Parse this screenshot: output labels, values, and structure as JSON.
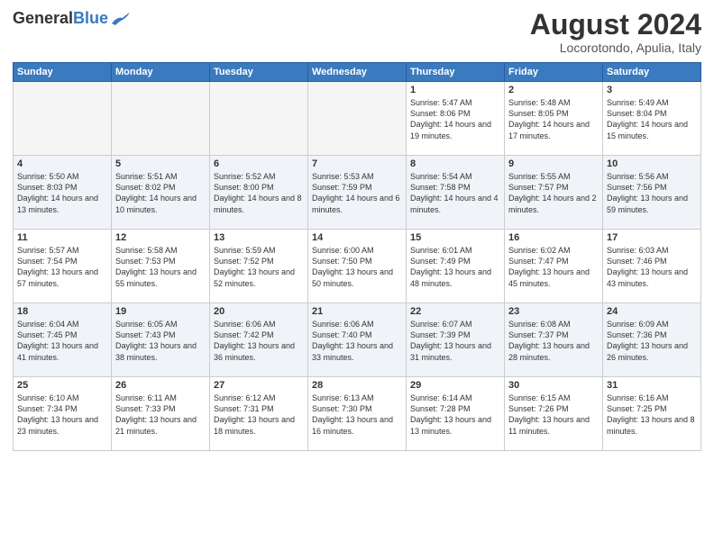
{
  "header": {
    "logo_general": "General",
    "logo_blue": "Blue",
    "title": "August 2024",
    "location": "Locorotondo, Apulia, Italy"
  },
  "days_of_week": [
    "Sunday",
    "Monday",
    "Tuesday",
    "Wednesday",
    "Thursday",
    "Friday",
    "Saturday"
  ],
  "weeks": [
    [
      {
        "day": "",
        "empty": true
      },
      {
        "day": "",
        "empty": true
      },
      {
        "day": "",
        "empty": true
      },
      {
        "day": "",
        "empty": true
      },
      {
        "day": "1",
        "sunrise": "Sunrise: 5:47 AM",
        "sunset": "Sunset: 8:06 PM",
        "daylight": "Daylight: 14 hours and 19 minutes."
      },
      {
        "day": "2",
        "sunrise": "Sunrise: 5:48 AM",
        "sunset": "Sunset: 8:05 PM",
        "daylight": "Daylight: 14 hours and 17 minutes."
      },
      {
        "day": "3",
        "sunrise": "Sunrise: 5:49 AM",
        "sunset": "Sunset: 8:04 PM",
        "daylight": "Daylight: 14 hours and 15 minutes."
      }
    ],
    [
      {
        "day": "4",
        "sunrise": "Sunrise: 5:50 AM",
        "sunset": "Sunset: 8:03 PM",
        "daylight": "Daylight: 14 hours and 13 minutes."
      },
      {
        "day": "5",
        "sunrise": "Sunrise: 5:51 AM",
        "sunset": "Sunset: 8:02 PM",
        "daylight": "Daylight: 14 hours and 10 minutes."
      },
      {
        "day": "6",
        "sunrise": "Sunrise: 5:52 AM",
        "sunset": "Sunset: 8:00 PM",
        "daylight": "Daylight: 14 hours and 8 minutes."
      },
      {
        "day": "7",
        "sunrise": "Sunrise: 5:53 AM",
        "sunset": "Sunset: 7:59 PM",
        "daylight": "Daylight: 14 hours and 6 minutes."
      },
      {
        "day": "8",
        "sunrise": "Sunrise: 5:54 AM",
        "sunset": "Sunset: 7:58 PM",
        "daylight": "Daylight: 14 hours and 4 minutes."
      },
      {
        "day": "9",
        "sunrise": "Sunrise: 5:55 AM",
        "sunset": "Sunset: 7:57 PM",
        "daylight": "Daylight: 14 hours and 2 minutes."
      },
      {
        "day": "10",
        "sunrise": "Sunrise: 5:56 AM",
        "sunset": "Sunset: 7:56 PM",
        "daylight": "Daylight: 13 hours and 59 minutes."
      }
    ],
    [
      {
        "day": "11",
        "sunrise": "Sunrise: 5:57 AM",
        "sunset": "Sunset: 7:54 PM",
        "daylight": "Daylight: 13 hours and 57 minutes."
      },
      {
        "day": "12",
        "sunrise": "Sunrise: 5:58 AM",
        "sunset": "Sunset: 7:53 PM",
        "daylight": "Daylight: 13 hours and 55 minutes."
      },
      {
        "day": "13",
        "sunrise": "Sunrise: 5:59 AM",
        "sunset": "Sunset: 7:52 PM",
        "daylight": "Daylight: 13 hours and 52 minutes."
      },
      {
        "day": "14",
        "sunrise": "Sunrise: 6:00 AM",
        "sunset": "Sunset: 7:50 PM",
        "daylight": "Daylight: 13 hours and 50 minutes."
      },
      {
        "day": "15",
        "sunrise": "Sunrise: 6:01 AM",
        "sunset": "Sunset: 7:49 PM",
        "daylight": "Daylight: 13 hours and 48 minutes."
      },
      {
        "day": "16",
        "sunrise": "Sunrise: 6:02 AM",
        "sunset": "Sunset: 7:47 PM",
        "daylight": "Daylight: 13 hours and 45 minutes."
      },
      {
        "day": "17",
        "sunrise": "Sunrise: 6:03 AM",
        "sunset": "Sunset: 7:46 PM",
        "daylight": "Daylight: 13 hours and 43 minutes."
      }
    ],
    [
      {
        "day": "18",
        "sunrise": "Sunrise: 6:04 AM",
        "sunset": "Sunset: 7:45 PM",
        "daylight": "Daylight: 13 hours and 41 minutes."
      },
      {
        "day": "19",
        "sunrise": "Sunrise: 6:05 AM",
        "sunset": "Sunset: 7:43 PM",
        "daylight": "Daylight: 13 hours and 38 minutes."
      },
      {
        "day": "20",
        "sunrise": "Sunrise: 6:06 AM",
        "sunset": "Sunset: 7:42 PM",
        "daylight": "Daylight: 13 hours and 36 minutes."
      },
      {
        "day": "21",
        "sunrise": "Sunrise: 6:06 AM",
        "sunset": "Sunset: 7:40 PM",
        "daylight": "Daylight: 13 hours and 33 minutes."
      },
      {
        "day": "22",
        "sunrise": "Sunrise: 6:07 AM",
        "sunset": "Sunset: 7:39 PM",
        "daylight": "Daylight: 13 hours and 31 minutes."
      },
      {
        "day": "23",
        "sunrise": "Sunrise: 6:08 AM",
        "sunset": "Sunset: 7:37 PM",
        "daylight": "Daylight: 13 hours and 28 minutes."
      },
      {
        "day": "24",
        "sunrise": "Sunrise: 6:09 AM",
        "sunset": "Sunset: 7:36 PM",
        "daylight": "Daylight: 13 hours and 26 minutes."
      }
    ],
    [
      {
        "day": "25",
        "sunrise": "Sunrise: 6:10 AM",
        "sunset": "Sunset: 7:34 PM",
        "daylight": "Daylight: 13 hours and 23 minutes."
      },
      {
        "day": "26",
        "sunrise": "Sunrise: 6:11 AM",
        "sunset": "Sunset: 7:33 PM",
        "daylight": "Daylight: 13 hours and 21 minutes."
      },
      {
        "day": "27",
        "sunrise": "Sunrise: 6:12 AM",
        "sunset": "Sunset: 7:31 PM",
        "daylight": "Daylight: 13 hours and 18 minutes."
      },
      {
        "day": "28",
        "sunrise": "Sunrise: 6:13 AM",
        "sunset": "Sunset: 7:30 PM",
        "daylight": "Daylight: 13 hours and 16 minutes."
      },
      {
        "day": "29",
        "sunrise": "Sunrise: 6:14 AM",
        "sunset": "Sunset: 7:28 PM",
        "daylight": "Daylight: 13 hours and 13 minutes."
      },
      {
        "day": "30",
        "sunrise": "Sunrise: 6:15 AM",
        "sunset": "Sunset: 7:26 PM",
        "daylight": "Daylight: 13 hours and 11 minutes."
      },
      {
        "day": "31",
        "sunrise": "Sunrise: 6:16 AM",
        "sunset": "Sunset: 7:25 PM",
        "daylight": "Daylight: 13 hours and 8 minutes."
      }
    ]
  ]
}
